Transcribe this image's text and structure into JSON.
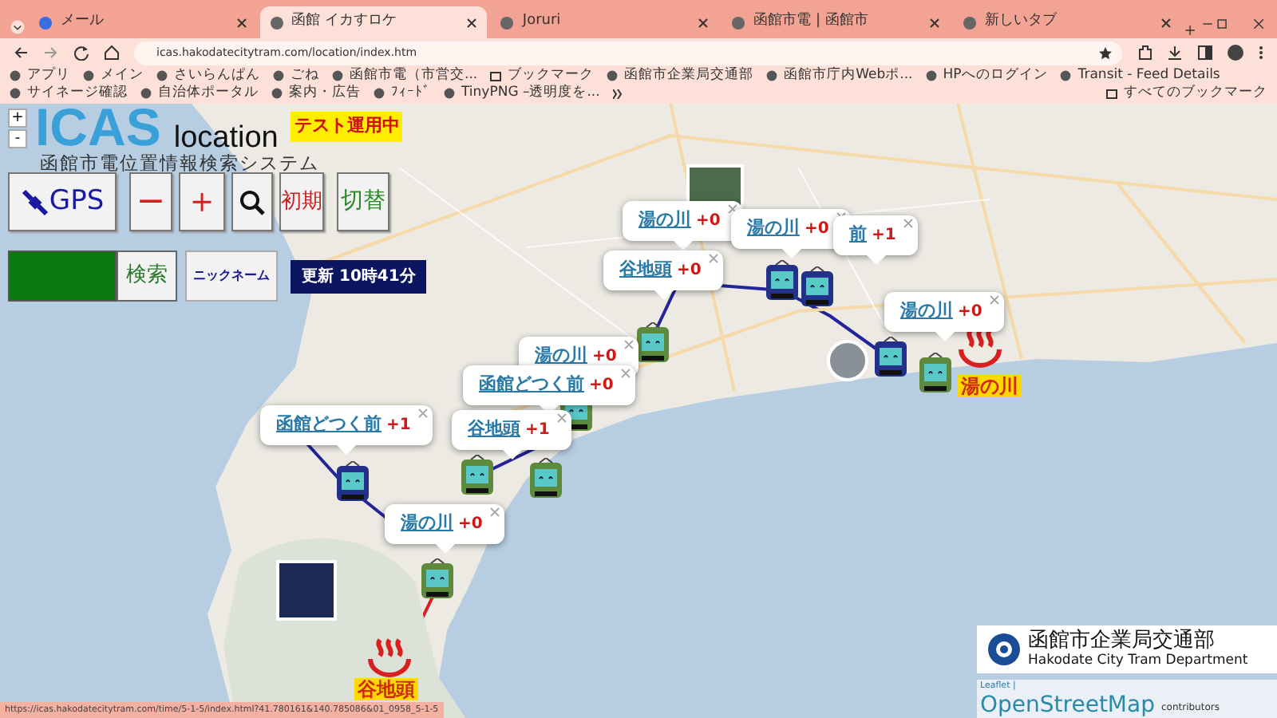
{
  "browser": {
    "tabs": [
      {
        "title": "メール",
        "selected": false
      },
      {
        "title": "函館 イカすロケ",
        "selected": true
      },
      {
        "title": "Joruri",
        "selected": false
      },
      {
        "title": "函館市電 | 函館市",
        "selected": false
      },
      {
        "title": "新しいタブ",
        "selected": false
      }
    ],
    "url": "icas.hakodatecitytram.com/location/index.htm",
    "bookmarks": [
      "アプリ",
      "メイン",
      "さいらんぱん",
      "ごね",
      "函館市電（市営交...",
      "ブックマーク",
      "函館市企業局交通部",
      "函館市庁内Webポ...",
      "HPへのログイン",
      "Transit - Feed Details",
      "サイネージ確認",
      "自治体ポータル",
      "案内・広告",
      "ﾌｨｰﾄﾞ",
      "TinyPNG –透明度を..."
    ],
    "all_bookmarks": "すべてのブックマーク",
    "status_url": "https://icas.hakodatecitytram.com/time/5-1-5/index.html?41.780161&140.785086&01_0958_5-1-5"
  },
  "map": {
    "zoom_in": "+",
    "zoom_out": "-",
    "logo": {
      "title": "ICAS",
      "subtitle": "location",
      "badge": "テスト運用中",
      "caption": "函館市電位置情報検索システム"
    },
    "buttons": [
      {
        "kind": "gps",
        "label": "GPS"
      },
      {
        "kind": "minus",
        "label": "−"
      },
      {
        "kind": "plus",
        "label": "＋"
      },
      {
        "kind": "search"
      },
      {
        "kind": "reset",
        "label": "初期"
      },
      {
        "kind": "toggle",
        "label": "切替"
      }
    ],
    "search_button": "検索",
    "nickname_button": "ニックネーム",
    "updated": "更新 10時41分",
    "popups": [
      {
        "stop": "湯の川",
        "delta": "+0"
      },
      {
        "stop": "湯の川",
        "delta": "+0"
      },
      {
        "stop": "前",
        "delta": "+1"
      },
      {
        "stop": "谷地頭",
        "delta": "+0"
      },
      {
        "stop": "湯の川",
        "delta": "+0"
      },
      {
        "stop": "湯の川",
        "delta": "+0"
      },
      {
        "stop": "函館どつく前",
        "delta": "+0"
      },
      {
        "stop": "谷地頭",
        "delta": "+1"
      },
      {
        "stop": "函館どつく前",
        "delta": "+1"
      },
      {
        "stop": "湯の川",
        "delta": "+0"
      }
    ],
    "trams": [
      {
        "color": "#22308a"
      },
      {
        "color": "#5d8a3c"
      },
      {
        "color": "#5d8a3c"
      },
      {
        "color": "#5d8a3c"
      },
      {
        "color": "#5d8a3c"
      },
      {
        "color": "#22308a"
      },
      {
        "color": "#22308a"
      },
      {
        "color": "#22308a"
      },
      {
        "color": "#5d8a3c"
      },
      {
        "color": "#5d8a3c"
      }
    ],
    "landmarks": [
      "湯の川",
      "谷地頭"
    ],
    "operator": {
      "name": "函館市企業局交通部",
      "english": "Hakodate City Tram Department"
    },
    "attribution": {
      "leaflet": "Leaflet |",
      "osm": "OpenStreetMap",
      "contributors": "contributors"
    }
  }
}
